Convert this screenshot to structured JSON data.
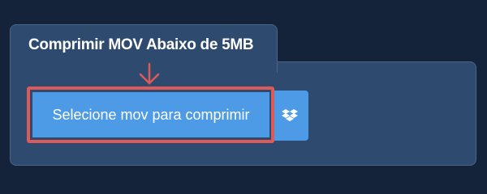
{
  "tab": {
    "title": "Comprimir MOV Abaixo de 5MB"
  },
  "upload": {
    "select_label": "Selecione mov para comprimir",
    "dropbox_icon": "dropbox-icon",
    "pointer_icon": "arrow-down-icon"
  },
  "colors": {
    "page_background": "#14233a",
    "panel_background": "#2e4a6e",
    "button_blue": "#4d9be6",
    "highlight_red": "#dd5a5a"
  }
}
